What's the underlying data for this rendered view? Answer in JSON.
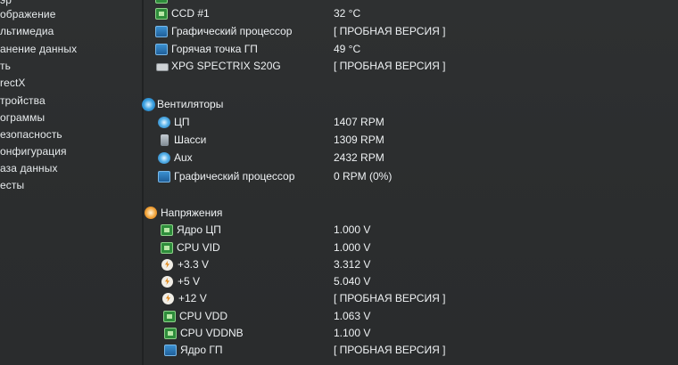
{
  "nav": {
    "items": [
      "эр",
      "ображение",
      "льтимедиа",
      "анение данных",
      "ть",
      "rectX",
      "тройства",
      "ограммы",
      "езопасность",
      "онфигурация",
      "аза данных",
      "есты"
    ]
  },
  "temps": {
    "top_partial": "—",
    "ccd1": {
      "label": "CCD #1",
      "value": "32 °C"
    },
    "gpu": {
      "label": "Графический процессор",
      "value": "[ ПРОБНАЯ ВЕРСИЯ ]"
    },
    "gpu_hotspot": {
      "label": "Горячая точка ГП",
      "value": "49 °C"
    },
    "ssd": {
      "label": "XPG SPECTRIX S20G",
      "value": "[ ПРОБНАЯ ВЕРСИЯ ]"
    }
  },
  "fans": {
    "title": "Вентиляторы",
    "cpu": {
      "label": "ЦП",
      "value": "1407 RPM"
    },
    "chassis": {
      "label": "Шасси",
      "value": "1309 RPM"
    },
    "aux": {
      "label": "Aux",
      "value": "2432 RPM"
    },
    "gpu": {
      "label": "Графический процессор",
      "value": "0 RPM  (0%)"
    }
  },
  "voltages": {
    "title": "Напряжения",
    "cpu_core": {
      "label": "Ядро ЦП",
      "value": "1.000 V"
    },
    "cpu_vid": {
      "label": "CPU VID",
      "value": "1.000 V"
    },
    "v33": {
      "label": "+3.3 V",
      "value": "3.312 V"
    },
    "v5": {
      "label": "+5 V",
      "value": "5.040 V"
    },
    "v12": {
      "label": "+12 V",
      "value": "[ ПРОБНАЯ ВЕРСИЯ ]"
    },
    "cpu_vdd": {
      "label": "CPU VDD",
      "value": "1.063 V"
    },
    "cpu_vddnb": {
      "label": "CPU VDDNB",
      "value": "1.100 V"
    },
    "gpu_core": {
      "label": "Ядро ГП",
      "value": "[ ПРОБНАЯ ВЕРСИЯ ]"
    }
  }
}
